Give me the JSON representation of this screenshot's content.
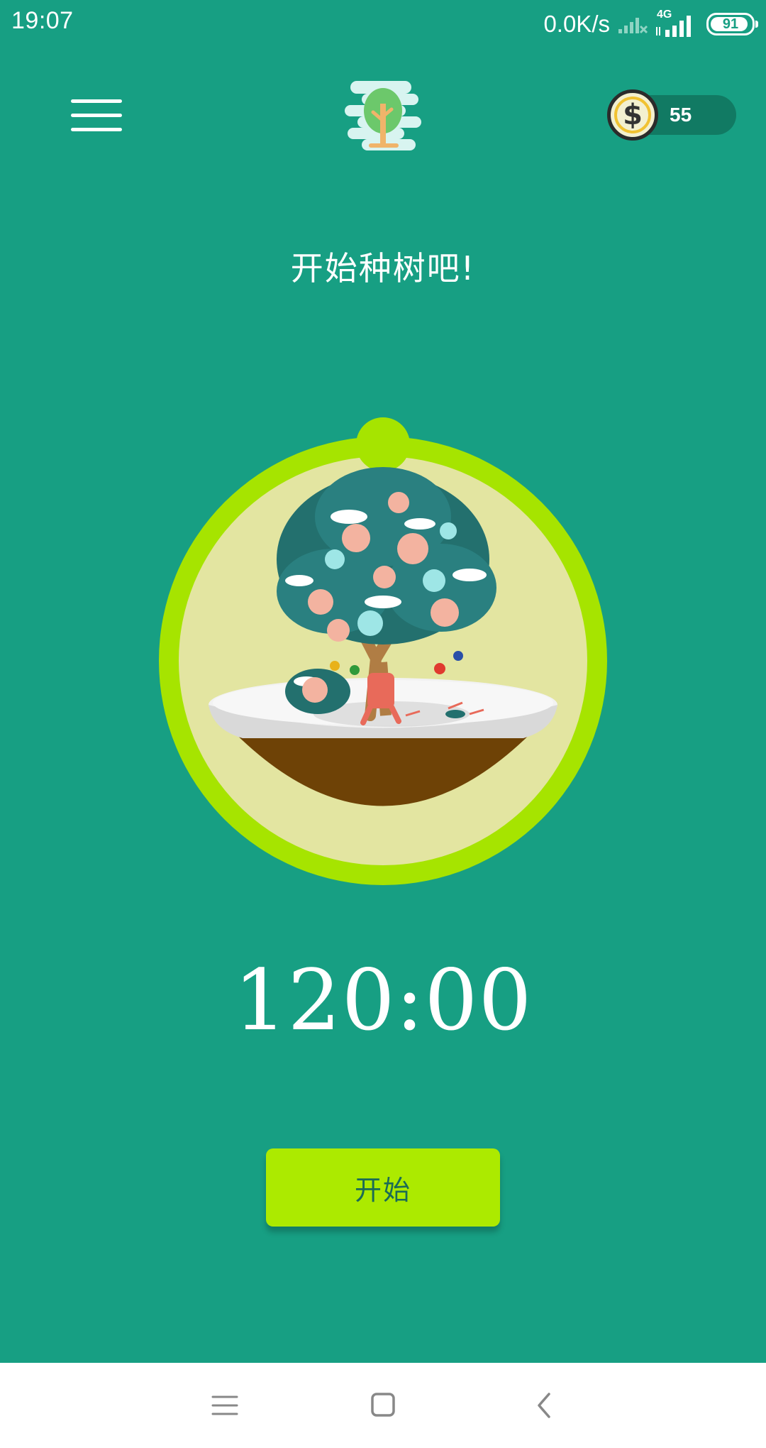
{
  "status_bar": {
    "time": "19:07",
    "net_speed": "0.0K/s",
    "network_type": "4G",
    "battery": "91"
  },
  "header": {
    "menu_icon": "hamburger-menu-icon",
    "logo_icon": "tree-logo-icon",
    "coins": "55",
    "coin_icon": "dollar-coin-icon"
  },
  "main": {
    "headline": "开始种树吧!",
    "timer": "120:00",
    "start_label": "开始",
    "tree_image": "snowy-blossom-tree-in-pot"
  },
  "nav_bar": {
    "recents_icon": "recents-icon",
    "home_icon": "home-icon",
    "back_icon": "back-icon"
  },
  "colors": {
    "background": "#179f83",
    "accent": "#acea00",
    "ring": "#a6e400",
    "soil": "#6e4206",
    "circle_fill": "#e3e5a1"
  }
}
